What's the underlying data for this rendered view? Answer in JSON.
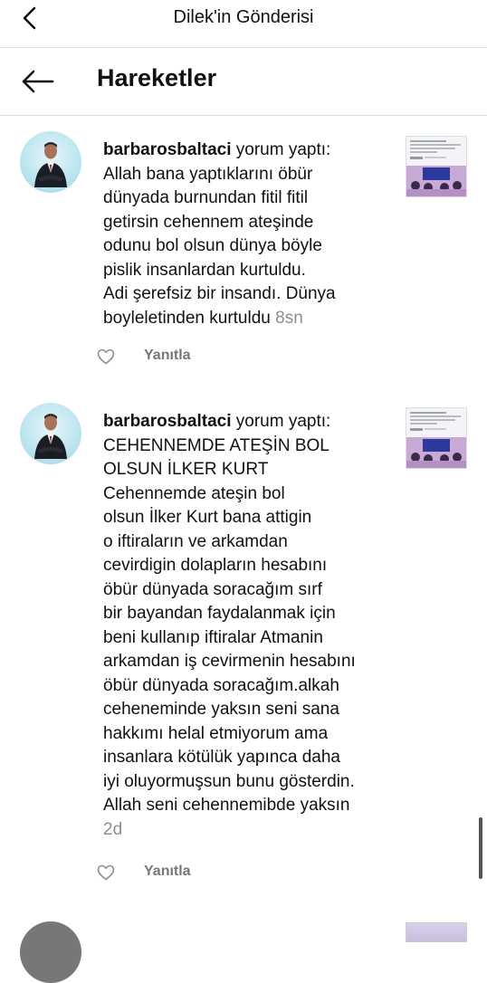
{
  "topbar": {
    "title": "Dilek'in Gönderisi"
  },
  "section": {
    "heading": "Hareketler"
  },
  "comments": [
    {
      "username": "barbarosbaltaci",
      "action": "yorum yaptı:",
      "lines": [
        "Allah bana yaptıklarını  öbür",
        "dünyada burnundan fitil fitil",
        "getirsin  cehennem ateşinde",
        "odunu bol olsun dünya böyle",
        "pislik insanlardan kurtuldu.",
        "Adi şerefsiz bir insandı. Dünya",
        "boyleletinden kurtuldu"
      ],
      "time": "8sn",
      "reply_label": "Yanıtla"
    },
    {
      "username": "barbarosbaltaci",
      "action": "yorum yaptı:",
      "lines": [
        "CEHENNEMDE ATEŞİN BOL",
        "OLSUN İLKER KURT",
        "Cehennemde ateşin bol",
        "olsun İlker Kurt bana attigin",
        "o iftiraların ve arkamdan",
        "cevirdigin dolapların hesabını",
        "öbür dünyada soracağım sırf",
        "bir bayandan faydalanmak için",
        "beni kullanıp iftiralar Atmanin",
        "arkamdan iş cevirmenin hesabını",
        "öbür dünyada soracağım.alkah",
        "ceheneminde yaksın seni sana",
        "hakkımı helal etmiyorum ama",
        "insanlara kötülük yapınca daha",
        "iyi oluyormuşsun bunu gösterdin.",
        "Allah seni cehennemibde yaksın"
      ],
      "time": "2d",
      "reply_label": "Yanıtla"
    }
  ],
  "icons": {
    "back": "chevron-left-icon",
    "arrow": "arrow-left-icon",
    "like": "heart-icon"
  }
}
